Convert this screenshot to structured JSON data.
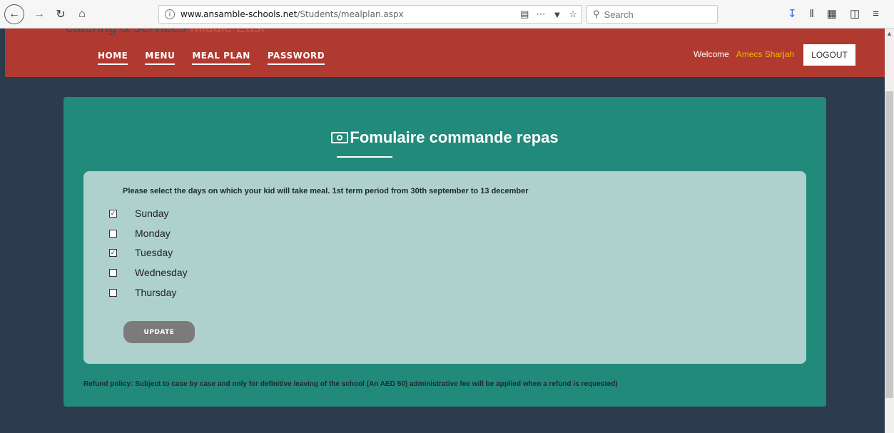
{
  "browser": {
    "url_host": "www.ansamble-schools.net",
    "url_path": "/Students/mealplan.aspx",
    "search_placeholder": "Search"
  },
  "header": {
    "brand_partial_gray": "catering & services ",
    "brand_partial_red": "Middle East",
    "nav": [
      "HOME",
      "MENU",
      "MEAL PLAN",
      "PASSWORD"
    ],
    "welcome_label": "Welcome",
    "user_name": "Amecs Sharjah",
    "logout_label": "LOGOUT"
  },
  "panel": {
    "title": "Fomulaire commande repas",
    "instructions": "Please select the days on which your kid will take meal. 1st term period from 30th september to 13 december",
    "days": [
      {
        "label": "Sunday",
        "checked": true
      },
      {
        "label": "Monday",
        "checked": false
      },
      {
        "label": "Tuesday",
        "checked": true
      },
      {
        "label": "Wednesday",
        "checked": false
      },
      {
        "label": "Thursday",
        "checked": false
      }
    ],
    "update_label": "UPDATE",
    "refund_policy": "Refund policy:  Subject to case by case and only for definitive leaving of the school (An AED 50) administrative fee will be applied when a refund is requested)"
  },
  "colors": {
    "header_bg": "#b03a30",
    "page_bg": "#2c3b4e",
    "panel_bg": "#218a7b",
    "form_bg": "#aed1ce",
    "user_name": "#f5b400"
  }
}
